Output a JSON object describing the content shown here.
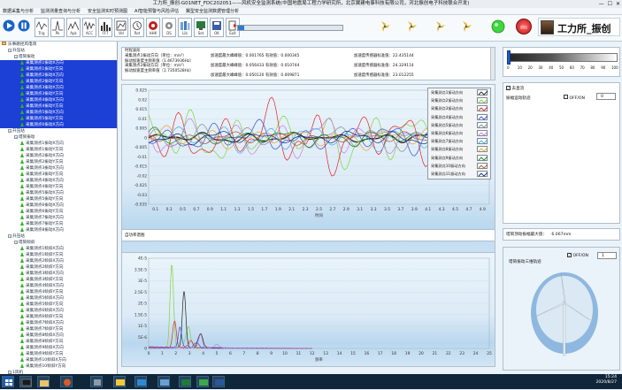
{
  "window": {
    "title": "工力所_振创-G01NET_FDC202051——风机安全监测系统(中国地震局工程力学研究所，北京翼建电事科技有限公司，河北振创电子科技联合开发)",
    "min": "—",
    "max": "☐",
    "close": "✕"
  },
  "menu": [
    "数据采集与分析",
    "监测测量查询与分析",
    "安全监测实时预测图",
    "AI智能预警与风险评估",
    "翼型安全监测数据管理分析"
  ],
  "toolbar": {
    "btns": [
      "启动",
      "暂停",
      "Trig",
      "Pk",
      "Apk",
      "ACC",
      "FFT",
      "Vel",
      "Rot",
      "HHK",
      "DS",
      "Lib",
      "Set",
      "OK",
      "Exit"
    ],
    "stop_label": "退出",
    "brand": "工力所_振创"
  },
  "info": {
    "title": "时程波形",
    "lines": [
      "采集测点1振动方向（单位：m/s²）",
      "振动加速度主频率值（1.4673936Hz）",
      "采集测点2振动方向（单位：m/s²）",
      "振动加速度主频率值（1.7350528Hz）"
    ],
    "col2": [
      "加速度最大峰峰值：0.001765 有效值：0.000345",
      "加速度最大峰峰值：0.056433 有效值：0.010744",
      "加速度最大峰峰值：0.050120 有效值：0.009871"
    ],
    "col3": [
      "加速度传感器标准值：22.435144",
      "加速度传感器标准值：24.329114",
      "加速度传感器标准值：23.012255"
    ]
  },
  "spectrum_header": "自功率谱图",
  "legend": [
    "采集测点1振动方向",
    "采集测点2振动方向",
    "采集测点3振动方向",
    "采集测点4振动方向",
    "采集测点5振动方向",
    "采集测点6振动方向",
    "采集测点7振动方向",
    "采集测点8振动方向",
    "采集测点9振动方向",
    "采集测点10振动方向",
    "采集测点11振动方向"
  ],
  "right": {
    "slider_ticks": [
      "0",
      "10",
      "20",
      "30",
      "40",
      "50",
      "60",
      "70",
      "80",
      "90",
      "100"
    ],
    "checkbox1": "去直流",
    "checkbox2": "OFF/ON",
    "label1": "振幅运动轨迹",
    "stepper1": "0",
    "label2": "塔筒顶动振幅最大值：",
    "value2": "6.067mm",
    "checkbox3": "OFF/ON",
    "label3": "塔筒振动三维轨迹",
    "stepper2": "1"
  },
  "tree": [
    {
      "lvl": 0,
      "t": "folder",
      "text": "乐事路径风电场"
    },
    {
      "lvl": 1,
      "t": "exp",
      "text": "升压站"
    },
    {
      "lvl": 2,
      "t": "exp",
      "text": "塔筒振动"
    },
    {
      "lvl": 3,
      "t": "tri",
      "text": "采集测点1振动X方向",
      "sel": true
    },
    {
      "lvl": 3,
      "t": "tri",
      "text": "采集测点1振动Y方向",
      "sel": true
    },
    {
      "lvl": 3,
      "t": "tri",
      "text": "采集测点2振动X方向",
      "sel": true
    },
    {
      "lvl": 3,
      "t": "tri",
      "text": "采集测点2振动Y方向",
      "sel": true
    },
    {
      "lvl": 3,
      "t": "tri",
      "text": "采集测点3振动X方向",
      "sel": true
    },
    {
      "lvl": 3,
      "t": "tri",
      "text": "采集测点3振动Y方向",
      "sel": true
    },
    {
      "lvl": 3,
      "t": "tri",
      "text": "采集测点4振动X方向",
      "sel": true
    },
    {
      "lvl": 3,
      "t": "tri",
      "text": "采集测点4振动Y方向",
      "sel": true
    },
    {
      "lvl": 3,
      "t": "tri",
      "text": "采集测点5振动X方向",
      "sel": true
    },
    {
      "lvl": 3,
      "t": "tri",
      "text": "采集测点5振动Y方向",
      "sel": true
    },
    {
      "lvl": 3,
      "t": "tri",
      "text": "采集测点6振动X方向",
      "sel": true
    },
    {
      "lvl": 1,
      "t": "exp",
      "text": "升压站"
    },
    {
      "lvl": 2,
      "t": "exp",
      "text": "塔筒振动"
    },
    {
      "lvl": 3,
      "t": "tri",
      "text": "采集测点1振动X方向"
    },
    {
      "lvl": 3,
      "t": "tri",
      "text": "采集测点1振动Y方向"
    },
    {
      "lvl": 3,
      "t": "tri",
      "text": "采集测点2振动X方向"
    },
    {
      "lvl": 3,
      "t": "tri",
      "text": "采集测点2振动Y方向"
    },
    {
      "lvl": 3,
      "t": "tri",
      "text": "采集测点3振动X方向"
    },
    {
      "lvl": 3,
      "t": "tri",
      "text": "采集测点3振动Y方向"
    },
    {
      "lvl": 3,
      "t": "tri",
      "text": "采集测点4振动X方向"
    },
    {
      "lvl": 3,
      "t": "tri",
      "text": "采集测点4振动Y方向"
    },
    {
      "lvl": 3,
      "t": "tri",
      "text": "采集测点5振动X方向"
    },
    {
      "lvl": 3,
      "t": "tri",
      "text": "采集测点5振动Y方向"
    },
    {
      "lvl": 3,
      "t": "tri",
      "text": "采集测点6振动X方向"
    },
    {
      "lvl": 3,
      "t": "tri",
      "text": "采集测点6振动Y方向"
    },
    {
      "lvl": 3,
      "t": "tri",
      "text": "采集测点7振动X方向"
    },
    {
      "lvl": 3,
      "t": "tri",
      "text": "采集测点7振动Y方向"
    },
    {
      "lvl": 3,
      "t": "tri",
      "text": "采集测点8振动X方向"
    },
    {
      "lvl": 1,
      "t": "exp",
      "text": "升压站"
    },
    {
      "lvl": 2,
      "t": "exp",
      "text": "塔筒倾斜"
    },
    {
      "lvl": 3,
      "t": "tri",
      "text": "采集测点1倾斜X方向"
    },
    {
      "lvl": 3,
      "t": "tri",
      "text": "采集测点1倾斜Y方向"
    },
    {
      "lvl": 3,
      "t": "tri",
      "text": "采集测点2倾斜X方向"
    },
    {
      "lvl": 3,
      "t": "tri",
      "text": "采集测点2倾斜Y方向"
    },
    {
      "lvl": 3,
      "t": "tri",
      "text": "采集测点3倾斜X方向"
    },
    {
      "lvl": 3,
      "t": "tri",
      "text": "采集测点3倾斜Y方向"
    },
    {
      "lvl": 3,
      "t": "tri",
      "text": "采集测点4倾斜X方向"
    },
    {
      "lvl": 3,
      "t": "tri",
      "text": "采集测点4倾斜Y方向"
    },
    {
      "lvl": 3,
      "t": "tri",
      "text": "采集测点5倾斜X方向"
    },
    {
      "lvl": 3,
      "t": "tri",
      "text": "采集测点5倾斜Y方向"
    },
    {
      "lvl": 3,
      "t": "tri",
      "text": "采集测点6倾斜X方向"
    },
    {
      "lvl": 3,
      "t": "tri",
      "text": "采集测点6倾斜Y方向"
    },
    {
      "lvl": 3,
      "t": "tri",
      "text": "采集测点7倾斜X方向"
    },
    {
      "lvl": 3,
      "t": "tri",
      "text": "采集测点7倾斜Y方向"
    },
    {
      "lvl": 3,
      "t": "tri",
      "text": "采集测点8倾斜X方向"
    },
    {
      "lvl": 3,
      "t": "tri",
      "text": "采集测点8倾斜Y方向"
    },
    {
      "lvl": 3,
      "t": "tri",
      "text": "采集测点9倾斜X方向"
    },
    {
      "lvl": 3,
      "t": "tri",
      "text": "采集测点9倾斜Y方向"
    },
    {
      "lvl": 3,
      "t": "tri",
      "text": "采集测点10倾斜X方向"
    },
    {
      "lvl": 3,
      "t": "tri",
      "text": "采集测点10倾斜Y方向"
    },
    {
      "lvl": 1,
      "t": "exp",
      "text": "1风机"
    },
    {
      "lvl": 2,
      "t": "exp",
      "text": "塔筒倾斜"
    },
    {
      "lvl": 3,
      "t": "tri",
      "text": "采集测点1倾斜X方向"
    }
  ],
  "chart_data": [
    {
      "type": "line",
      "title": "时程波形",
      "xlabel": "时间",
      "x_ticks": [
        "0.1",
        "0.2",
        "0.3",
        "0.4",
        "0.5",
        "0.6",
        "0.7",
        "0.8",
        "0.9",
        "1",
        "1.1",
        "1.2",
        "1.3",
        "1.4",
        "1.5",
        "1.6",
        "1.7",
        "1.8",
        "1.9",
        "2",
        "2.1",
        "2.2",
        "2.3",
        "2.4",
        "2.5",
        "2.6",
        "2.7",
        "2.8",
        "2.9",
        "3",
        "3.1",
        "3.2",
        "3.3",
        "3.4",
        "3.5",
        "3.6",
        "3.7",
        "3.8",
        "3.9",
        "4",
        "4.1",
        "4.2",
        "4.3",
        "4.4",
        "4.5",
        "4.6",
        "4.7",
        "4.8",
        "4.9"
      ],
      "ylim": [
        -0.035,
        0.025
      ],
      "y_ticks": [
        "0.025",
        "0.02",
        "0.015",
        "0.01",
        "0.005",
        "0",
        "-0.005",
        "-0.01",
        "-0.015",
        "-0.02",
        "-0.025",
        "-0.03",
        "-0.035"
      ],
      "series": [
        {
          "name": "采集测点1振动X方向",
          "color": "#222222",
          "amp": 0.003
        },
        {
          "name": "采集测点1振动Y方向",
          "color": "#7fd43a",
          "amp": 0.016
        },
        {
          "name": "采集测点2振动X方向",
          "color": "#e62222",
          "amp": 0.02
        },
        {
          "name": "采集测点2振动Y方向",
          "color": "#2f4fd6",
          "amp": 0.009
        },
        {
          "name": "采集测点3振动X方向",
          "color": "#8b8b8b",
          "amp": 0.007
        },
        {
          "name": "采集测点3振动Y方向",
          "color": "#c77de0",
          "amp": 0.012
        },
        {
          "name": "采集测点4振动X方向",
          "color": "#4aa8e8",
          "amp": 0.008
        },
        {
          "name": "采集测点4振动Y方向",
          "color": "#f0a030",
          "amp": 0.006
        },
        {
          "name": "采集测点5振动X方向",
          "color": "#1b7a2a",
          "amp": 0.005
        },
        {
          "name": "采集测点5振动Y方向",
          "color": "#a55a2a",
          "amp": 0.004
        },
        {
          "name": "采集测点6振动X方向",
          "color": "#0c2a7a",
          "amp": 0.004
        }
      ]
    },
    {
      "type": "line",
      "title": "自功率谱图",
      "xlabel": "频率",
      "x_ticks": [
        "0",
        "1",
        "2",
        "3",
        "4",
        "5",
        "6",
        "7",
        "8",
        "9",
        "10",
        "11",
        "12",
        "13",
        "14",
        "15",
        "16",
        "17",
        "18",
        "19",
        "20",
        "21",
        "22",
        "23",
        "24",
        "25"
      ],
      "ylim": [
        0,
        4.0
      ],
      "y_ticks": [
        "4E-5",
        "3.5E-5",
        "3E-5",
        "2.5E-5",
        "2E-5",
        "1.5E-5",
        "1E-5",
        "5E-6",
        "0"
      ],
      "series": [
        {
          "name": "采集测点1振动X方向",
          "color": "#7fd43a",
          "peak_x": 1.7,
          "peak_y": 3.7
        },
        {
          "name": "采集测点2振动X方向",
          "color": "#222222",
          "peak_x": 2.6,
          "peak_y": 2.5
        },
        {
          "name": "采集测点2振动Y方向",
          "color": "#e62222",
          "peak_x": 1.9,
          "peak_y": 1.2
        },
        {
          "name": "采集测点3振动X方向",
          "color": "#2f4fd6",
          "peak_x": 2.3,
          "peak_y": 0.9
        },
        {
          "name": "采集测点4振动X方向",
          "color": "#c77de0",
          "peak_x": 3.8,
          "peak_y": 0.6
        }
      ]
    }
  ],
  "taskbar": {
    "time": "15:24",
    "date": "2020/8/27"
  }
}
